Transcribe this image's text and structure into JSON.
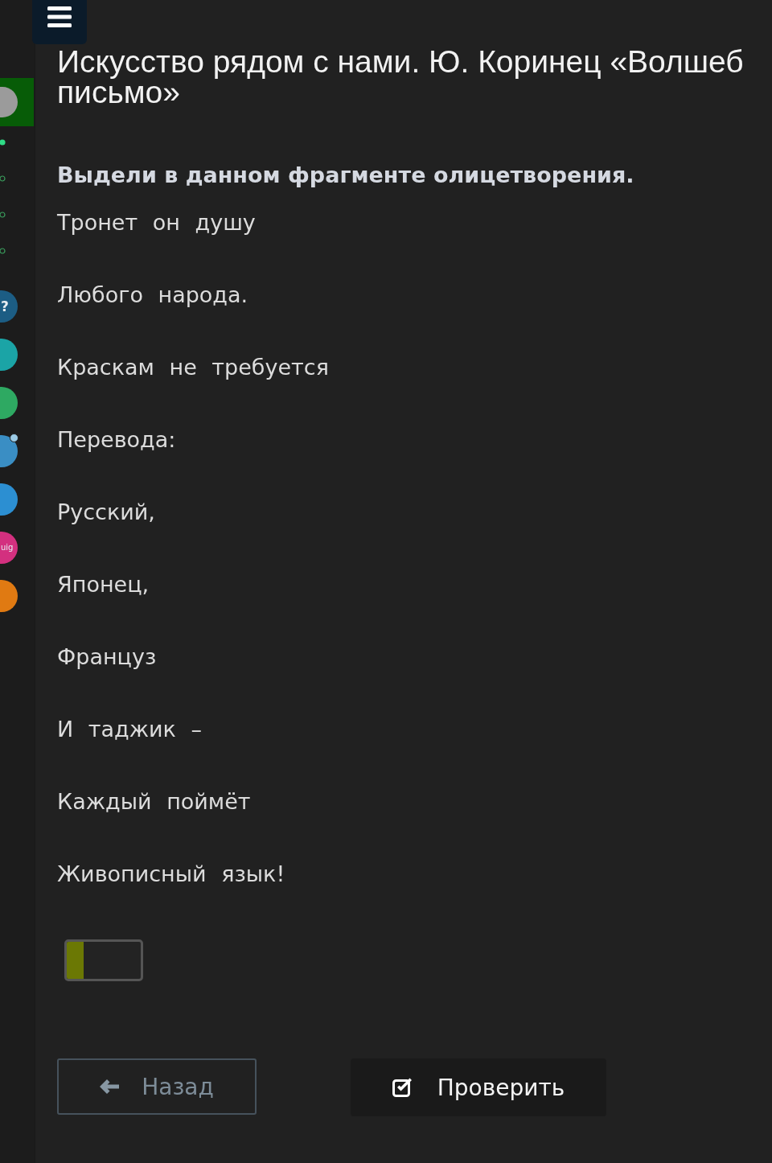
{
  "sidebar": {
    "lesson": {
      "selected": true
    },
    "steps": [
      {
        "selected": true
      },
      {
        "selected": false
      },
      {
        "selected": false
      },
      {
        "selected": false
      }
    ],
    "apps": [
      {
        "color": "#1c5d84",
        "label": "?"
      },
      {
        "color": "#1ba4a6"
      },
      {
        "color": "#2ea962"
      },
      {
        "color": "#3a8ec4",
        "badge": true
      },
      {
        "color": "#2c8fd2"
      },
      {
        "color": "#d3307f",
        "label": "uig"
      },
      {
        "color": "#e07a12"
      }
    ]
  },
  "title_lines": [
    "Искусство рядом с нами. Ю. Коринец «Волшеб",
    "письмо»"
  ],
  "question": "Выдели в данном фрагменте олицетворения.",
  "poem_lines": [
    "Тронет он душу",
    "Любого народа.",
    "Краскам не требуется",
    "Перевода:",
    "Русский,",
    "Японец,",
    "Француз",
    "И таджик –",
    "Каждый поймёт",
    "Живописный язык!"
  ],
  "answer_toggle": {
    "on": false
  },
  "back_button": {
    "label": "Назад",
    "disabled": true
  },
  "check_button": {
    "label": "Проверить",
    "disabled": false
  }
}
